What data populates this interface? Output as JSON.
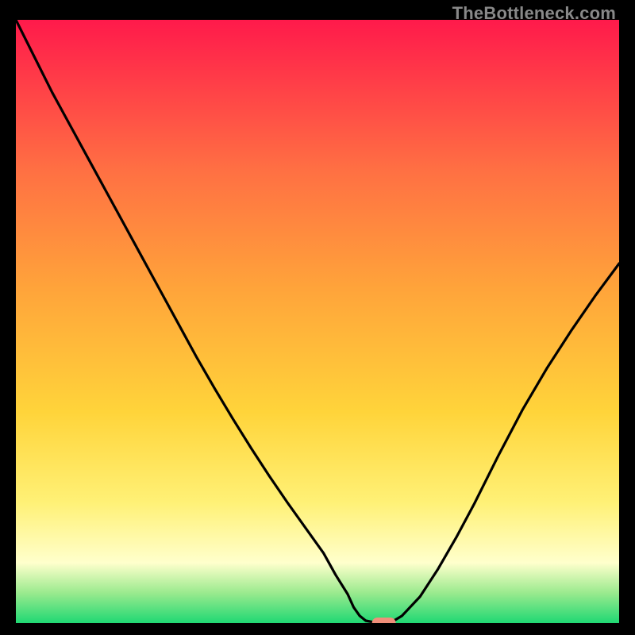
{
  "watermark": "TheBottleneck.com",
  "colors": {
    "top": "#ff1a4b",
    "mid1": "#ff7043",
    "mid2": "#ffa53a",
    "mid3": "#ffd43a",
    "mid4": "#fff176",
    "paleYellow": "#ffffcc",
    "lightGreen": "#9aea8e",
    "green": "#1fd873",
    "curve": "#000000",
    "marker": "#f08f7a",
    "frame": "#000000"
  },
  "chart_data": {
    "type": "line",
    "title": "",
    "xlabel": "",
    "ylabel": "",
    "xlim": [
      0,
      100
    ],
    "ylim": [
      0,
      100
    ],
    "x": [
      0,
      3,
      6,
      9,
      12,
      15,
      18,
      21,
      24,
      27,
      30,
      33,
      36,
      39,
      42,
      45,
      48,
      51,
      53,
      55,
      56,
      57,
      58,
      60,
      62,
      64,
      67,
      70,
      73,
      76,
      80,
      84,
      88,
      92,
      96,
      100
    ],
    "values": [
      100,
      94,
      88,
      82.5,
      77,
      71.5,
      66,
      60.5,
      55,
      49.5,
      44,
      38.8,
      33.8,
      29,
      24.4,
      20,
      15.8,
      11.6,
      8.0,
      4.8,
      2.6,
      1.2,
      0.4,
      0,
      0,
      1.2,
      4.4,
      9.0,
      14.2,
      19.8,
      27.8,
      35.4,
      42.2,
      48.4,
      54.2,
      59.6
    ],
    "marker": {
      "x": 61,
      "y": 0
    },
    "annotations": []
  }
}
